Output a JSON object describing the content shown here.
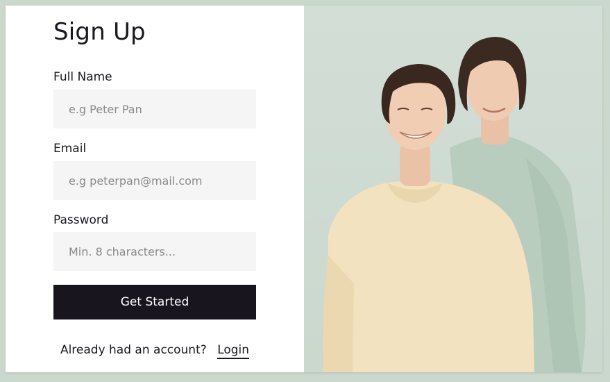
{
  "form": {
    "title": "Sign Up",
    "full_name": {
      "label": "Full Name",
      "placeholder": "e.g Peter Pan",
      "value": ""
    },
    "email": {
      "label": "Email",
      "placeholder": "e.g peterpan@mail.com",
      "value": ""
    },
    "password": {
      "label": "Password",
      "placeholder": "Min. 8 characters...",
      "value": ""
    },
    "submit_label": "Get Started",
    "footer_text": "Already had an account?",
    "login_label": "Login"
  },
  "colors": {
    "button_bg": "#19151f",
    "input_bg": "#f5f5f5",
    "photo_bg": "#cfdcd2"
  }
}
